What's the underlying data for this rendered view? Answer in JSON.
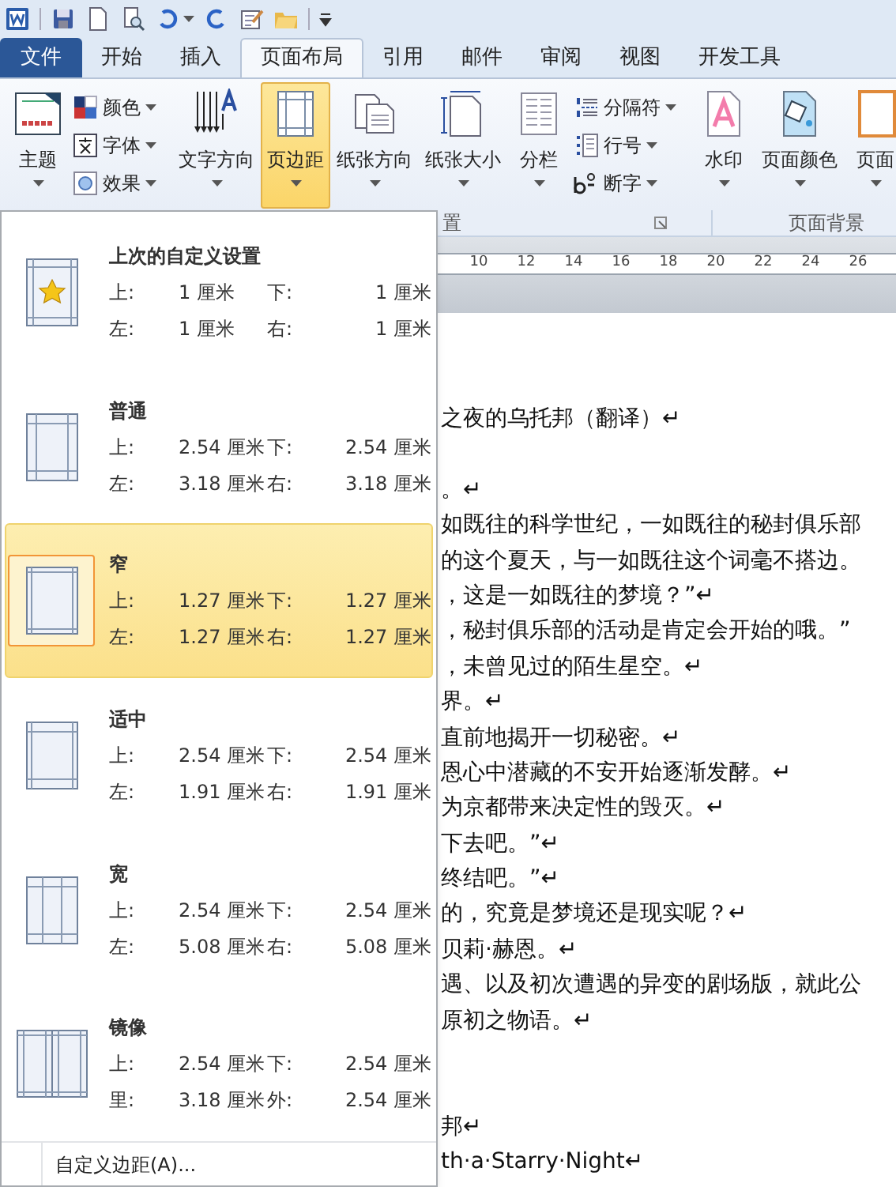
{
  "tabs": [
    {
      "label": "文件",
      "kind": "file",
      "selected": false
    },
    {
      "label": "开始",
      "kind": "normal",
      "selected": false
    },
    {
      "label": "插入",
      "kind": "normal",
      "selected": false
    },
    {
      "label": "页面布局",
      "kind": "normal",
      "selected": true
    },
    {
      "label": "引用",
      "kind": "normal",
      "selected": false
    },
    {
      "label": "邮件",
      "kind": "normal",
      "selected": false
    },
    {
      "label": "审阅",
      "kind": "normal",
      "selected": false
    },
    {
      "label": "视图",
      "kind": "normal",
      "selected": false
    },
    {
      "label": "开发工具",
      "kind": "normal",
      "selected": false
    }
  ],
  "ribbon": [
    {
      "kind": "large",
      "label": "主题",
      "selected": false
    },
    {
      "kind": "small-stack",
      "items": [
        {
          "label": "颜色"
        },
        {
          "label": "字体"
        },
        {
          "label": "效果"
        }
      ]
    },
    {
      "kind": "separator"
    },
    {
      "kind": "large",
      "label": "文字方向",
      "selected": false
    },
    {
      "kind": "large",
      "label": "页边距",
      "selected": true
    },
    {
      "kind": "large",
      "label": "纸张方向",
      "selected": false
    },
    {
      "kind": "large",
      "label": "纸张大小",
      "selected": false
    },
    {
      "kind": "large",
      "label": "分栏",
      "selected": false
    },
    {
      "kind": "small-stack",
      "items": [
        {
          "label": "分隔符"
        },
        {
          "label": "行号"
        },
        {
          "label": "断字"
        }
      ]
    },
    {
      "kind": "separator"
    },
    {
      "kind": "large",
      "label": "水印",
      "selected": false
    },
    {
      "kind": "large",
      "label": "页面颜色",
      "selected": false
    },
    {
      "kind": "large",
      "label": "页面",
      "selected": false
    }
  ],
  "group_labels": [
    "置",
    "页面背景"
  ],
  "ruler": [
    "10",
    "12",
    "14",
    "16",
    "18",
    "20",
    "22",
    "24",
    "26"
  ],
  "document_lines": [
    {
      "kind": "text",
      "text": "之夜的乌托邦（翻译）↵"
    },
    {
      "kind": "blank"
    },
    {
      "kind": "text",
      "text": "。↵"
    },
    {
      "kind": "text",
      "text": "如既往的科学世纪，一如既往的秘封俱乐部"
    },
    {
      "kind": "text",
      "text": "的这个夏天，与一如既往这个词毫不搭边。"
    },
    {
      "kind": "text",
      "text": "，这是一如既往的梦境？”↵"
    },
    {
      "kind": "text",
      "text": "，秘封俱乐部的活动是肯定会开始的哦。”"
    },
    {
      "kind": "text",
      "text": "，未曾见过的陌生星空。↵"
    },
    {
      "kind": "text",
      "text": "界。↵"
    },
    {
      "kind": "text",
      "text": "直前地揭开一切秘密。↵"
    },
    {
      "kind": "text",
      "text": "恩心中潜藏的不安开始逐渐发酵。↵"
    },
    {
      "kind": "text",
      "text": "为京都带来决定性的毁灭。↵"
    },
    {
      "kind": "text",
      "text": "下去吧。”↵"
    },
    {
      "kind": "text",
      "text": "终结吧。”↵"
    },
    {
      "kind": "text",
      "text": "的，究竟是梦境还是现实呢？↵"
    },
    {
      "kind": "text",
      "text": "贝莉·赫恩。↵"
    },
    {
      "kind": "text",
      "text": "遇、以及初次遭遇的异变的剧场版，就此公"
    },
    {
      "kind": "text",
      "text": "原初之物语。↵"
    },
    {
      "kind": "blank"
    },
    {
      "kind": "blank"
    },
    {
      "kind": "text",
      "text": "邦↵"
    },
    {
      "kind": "text",
      "text": "th·a·Starry·Night↵"
    }
  ],
  "margins_menu": {
    "items": [
      {
        "kind": "custom",
        "title": "上次的自定义设置",
        "selected": false,
        "rows": [
          [
            "上:",
            "1 厘米",
            "下:",
            "1 厘米"
          ],
          [
            "左:",
            "1 厘米",
            "右:",
            "1 厘米"
          ]
        ]
      },
      {
        "kind": "normal",
        "title": "普通",
        "selected": false,
        "rows": [
          [
            "上:",
            "2.54 厘米",
            "下:",
            "2.54 厘米"
          ],
          [
            "左:",
            "3.18 厘米",
            "右:",
            "3.18 厘米"
          ]
        ]
      },
      {
        "kind": "narrow",
        "title": "窄",
        "selected": true,
        "rows": [
          [
            "上:",
            "1.27 厘米",
            "下:",
            "1.27 厘米"
          ],
          [
            "左:",
            "1.27 厘米",
            "右:",
            "1.27 厘米"
          ]
        ]
      },
      {
        "kind": "moderate",
        "title": "适中",
        "selected": false,
        "rows": [
          [
            "上:",
            "2.54 厘米",
            "下:",
            "2.54 厘米"
          ],
          [
            "左:",
            "1.91 厘米",
            "右:",
            "1.91 厘米"
          ]
        ]
      },
      {
        "kind": "wide",
        "title": "宽",
        "selected": false,
        "rows": [
          [
            "上:",
            "2.54 厘米",
            "下:",
            "2.54 厘米"
          ],
          [
            "左:",
            "5.08 厘米",
            "右:",
            "5.08 厘米"
          ]
        ]
      },
      {
        "kind": "mirrored",
        "title": "镜像",
        "selected": false,
        "rows": [
          [
            "上:",
            "2.54 厘米",
            "下:",
            "2.54 厘米"
          ],
          [
            "里:",
            "3.18 厘米",
            "外:",
            "2.54 厘米"
          ]
        ]
      }
    ],
    "footer": "自定义边距(A)..."
  }
}
